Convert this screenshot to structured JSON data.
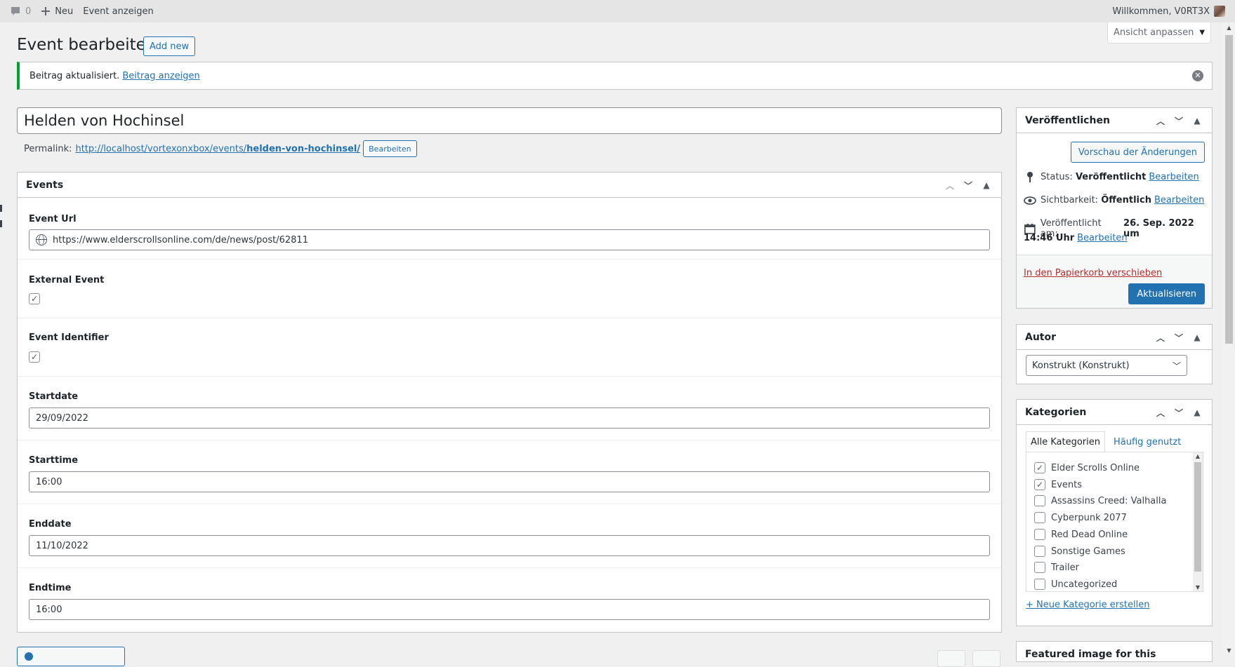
{
  "adminbar": {
    "comments_count": "0",
    "new_label": "Neu",
    "view_event_label": "Event anzeigen",
    "welcome": "Willkommen, V0RT3X"
  },
  "screen_options": {
    "label": "Ansicht anpassen"
  },
  "header": {
    "title": "Event bearbeiten",
    "add_new": "Add new"
  },
  "notice": {
    "text": "Beitrag aktualisiert.",
    "link": "Beitrag anzeigen"
  },
  "post": {
    "title": "Helden von Hochinsel",
    "permalink_label": "Permalink:",
    "permalink_base": "http://localhost/vortexonxbox/events/",
    "permalink_slug": "helden-von-hochinsel/",
    "permalink_edit": "Bearbeiten"
  },
  "events_box": {
    "title": "Events",
    "fields": {
      "url": {
        "label": "Event Url",
        "value": "https://www.elderscrollsonline.com/de/news/post/62811"
      },
      "external": {
        "label": "External Event",
        "checked": true
      },
      "identifier": {
        "label": "Event Identifier",
        "checked": true
      },
      "startdate": {
        "label": "Startdate",
        "value": "29/09/2022"
      },
      "starttime": {
        "label": "Starttime",
        "value": "16:00"
      },
      "enddate": {
        "label": "Enddate",
        "value": "11/10/2022"
      },
      "endtime": {
        "label": "Endtime",
        "value": "16:00"
      }
    }
  },
  "publish": {
    "title": "Veröffentlichen",
    "preview": "Vorschau der Änderungen",
    "status_label": "Status:",
    "status_value": "Veröffentlicht",
    "visibility_label": "Sichtbarkeit:",
    "visibility_value": "Öffentlich",
    "published_label": "Veröffentlicht am:",
    "published_value_1": "26. Sep. 2022 um",
    "published_value_2": "14:46 Uhr",
    "edit": "Bearbeiten",
    "trash": "In den Papierkorb verschieben",
    "update": "Aktualisieren"
  },
  "author": {
    "title": "Autor",
    "selected": "Konstrukt (Konstrukt)"
  },
  "categories": {
    "title": "Kategorien",
    "tab_all": "Alle Kategorien",
    "tab_popular": "Häufig genutzt",
    "items": [
      {
        "name": "Elder Scrolls Online",
        "checked": true
      },
      {
        "name": "Events",
        "checked": true
      },
      {
        "name": "Assassins Creed: Valhalla",
        "checked": false
      },
      {
        "name": "Cyberpunk 2077",
        "checked": false
      },
      {
        "name": "Red Dead Online",
        "checked": false
      },
      {
        "name": "Sonstige Games",
        "checked": false
      },
      {
        "name": "Trailer",
        "checked": false
      },
      {
        "name": "Uncategorized",
        "checked": false
      }
    ],
    "new_link": "+ Neue Kategorie erstellen"
  },
  "featured": {
    "title": "Featured image for this"
  },
  "icons": {
    "comment": "comment-icon",
    "plus": "plus-icon",
    "globe": "globe-icon",
    "pin": "pin-icon",
    "eye": "eye-icon",
    "calendar": "calendar-icon",
    "close": "close-icon"
  },
  "colors": {
    "accent": "#2271b1",
    "success": "#00a32a",
    "danger": "#b32d2e"
  }
}
